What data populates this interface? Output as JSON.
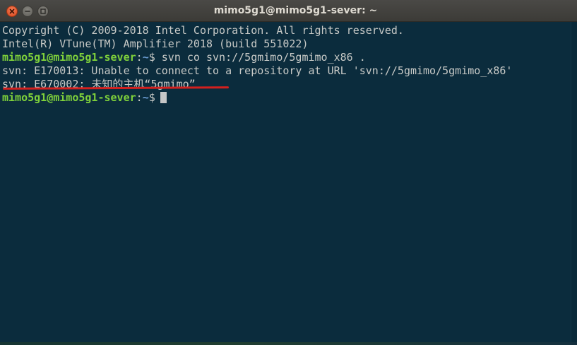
{
  "window": {
    "title": "mimo5g1@mimo5g1-sever: ~"
  },
  "icons": {
    "close": "close-icon",
    "minimize": "minimize-icon",
    "maximize": "maximize-icon"
  },
  "terminal": {
    "lines": [
      {
        "text": "Copyright (C) 2009-2018 Intel Corporation. All rights reserved."
      },
      {
        "text": "Intel(R) VTune(TM) Amplifier 2018 (build 551022)"
      },
      {
        "prompt_user": "mimo5g1@mimo5g1-sever",
        "prompt_sep": ":",
        "prompt_path": "~",
        "prompt_symbol": "$",
        "command": " svn co svn://5gmimo/5gmimo_x86 ."
      },
      {
        "text": "svn: E170013: Unable to connect to a repository at URL 'svn://5gmimo/5gmimo_x86'"
      },
      {
        "text": "svn: E670002: 未知的主机“5gmimo”"
      },
      {
        "prompt_user": "mimo5g1@mimo5g1-sever",
        "prompt_sep": ":",
        "prompt_path": "~",
        "prompt_symbol": "$",
        "command": ""
      }
    ]
  },
  "colors": {
    "background": "#0b2c3d",
    "text": "#c8cac7",
    "prompt_user": "#7fd13b",
    "prompt_path": "#6d9fd6",
    "annotation": "#d2201e"
  }
}
